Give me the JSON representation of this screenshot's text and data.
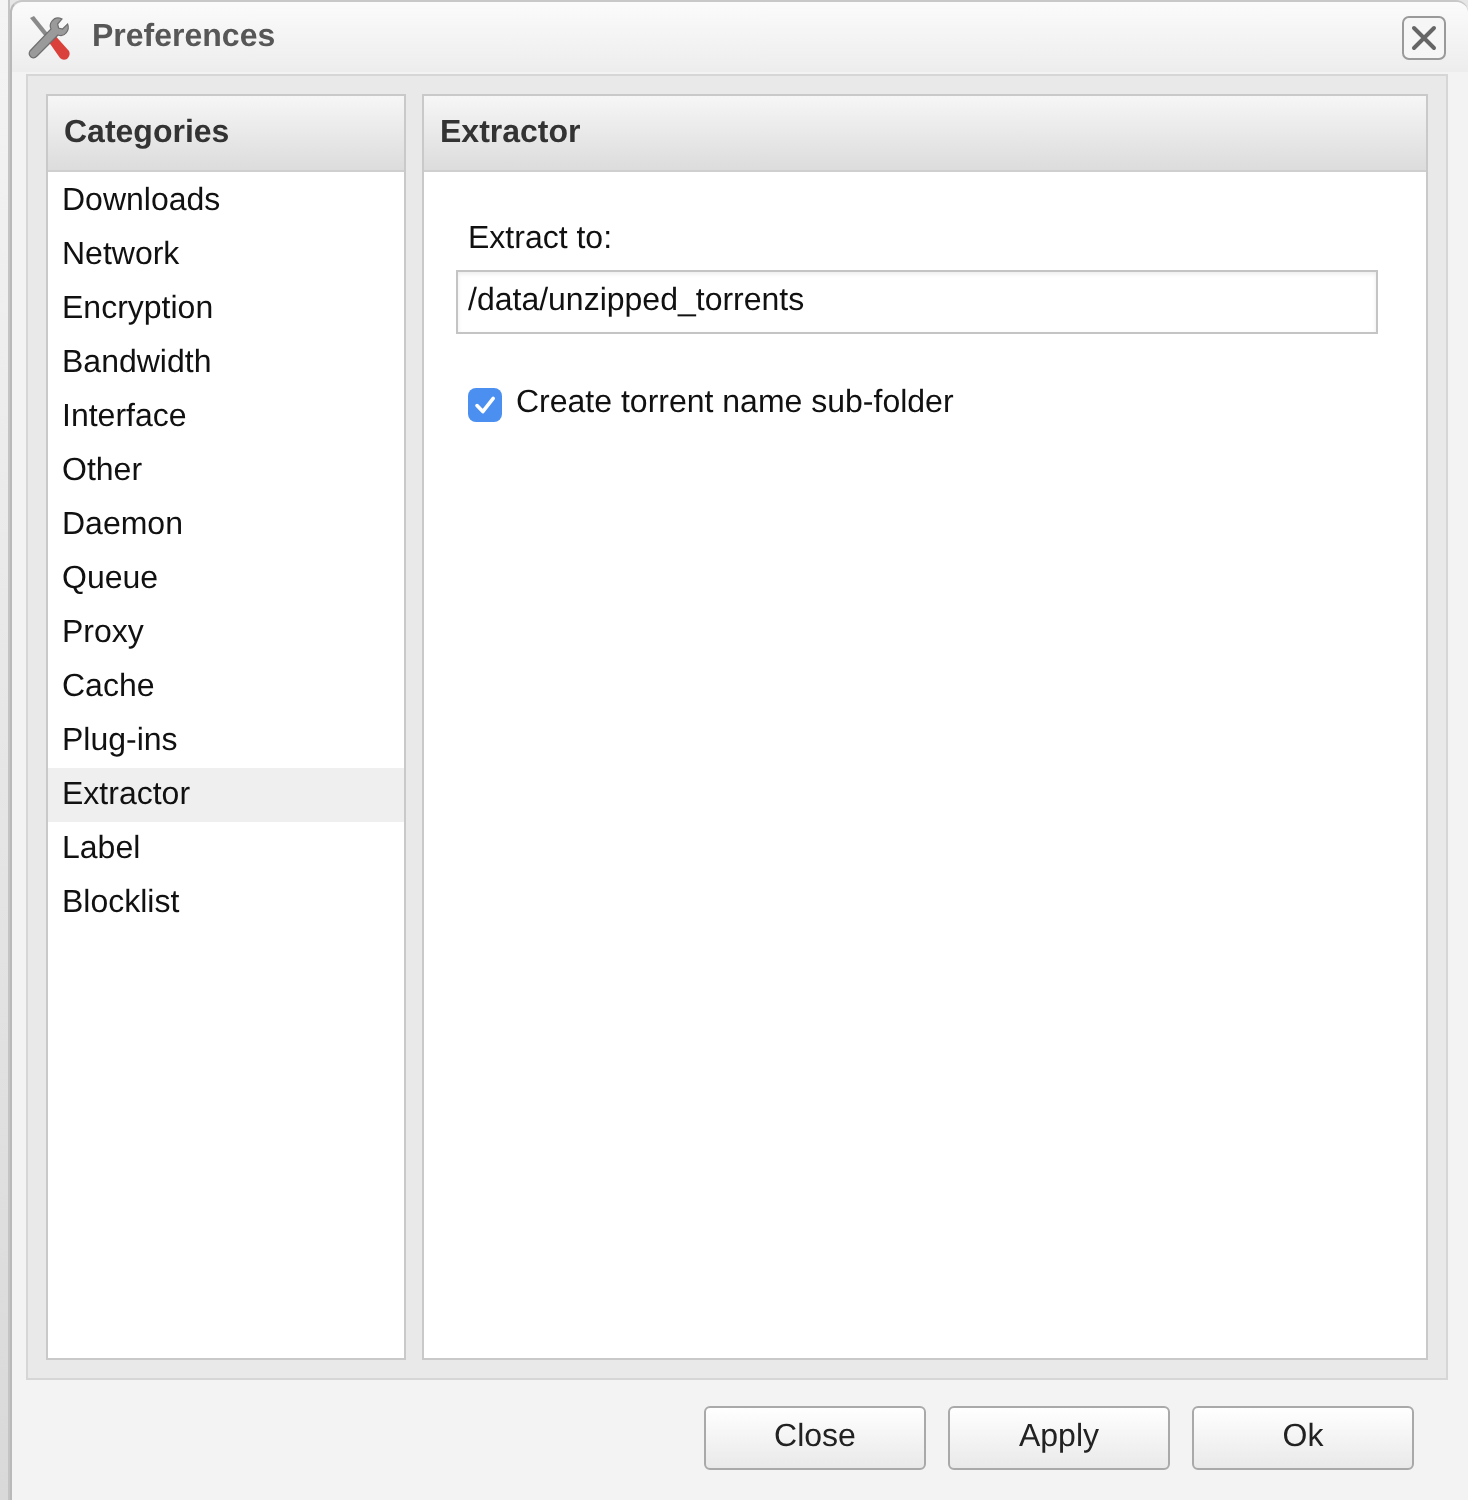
{
  "window": {
    "title": "Preferences"
  },
  "categories": {
    "title": "Categories",
    "items": [
      {
        "label": "Downloads",
        "selected": false
      },
      {
        "label": "Network",
        "selected": false
      },
      {
        "label": "Encryption",
        "selected": false
      },
      {
        "label": "Bandwidth",
        "selected": false
      },
      {
        "label": "Interface",
        "selected": false
      },
      {
        "label": "Other",
        "selected": false
      },
      {
        "label": "Daemon",
        "selected": false
      },
      {
        "label": "Queue",
        "selected": false
      },
      {
        "label": "Proxy",
        "selected": false
      },
      {
        "label": "Cache",
        "selected": false
      },
      {
        "label": "Plug-ins",
        "selected": false
      },
      {
        "label": "Extractor",
        "selected": true
      },
      {
        "label": "Label",
        "selected": false
      },
      {
        "label": "Blocklist",
        "selected": false
      }
    ]
  },
  "panel": {
    "title": "Extractor",
    "fields": [
      {
        "kind": "text",
        "label": "Extract to:",
        "value": "/data/unzipped_torrents"
      },
      {
        "kind": "checkbox",
        "label": "Create torrent name sub-folder",
        "checked": true
      }
    ]
  },
  "buttons": [
    "Close",
    "Apply",
    "Ok"
  ]
}
